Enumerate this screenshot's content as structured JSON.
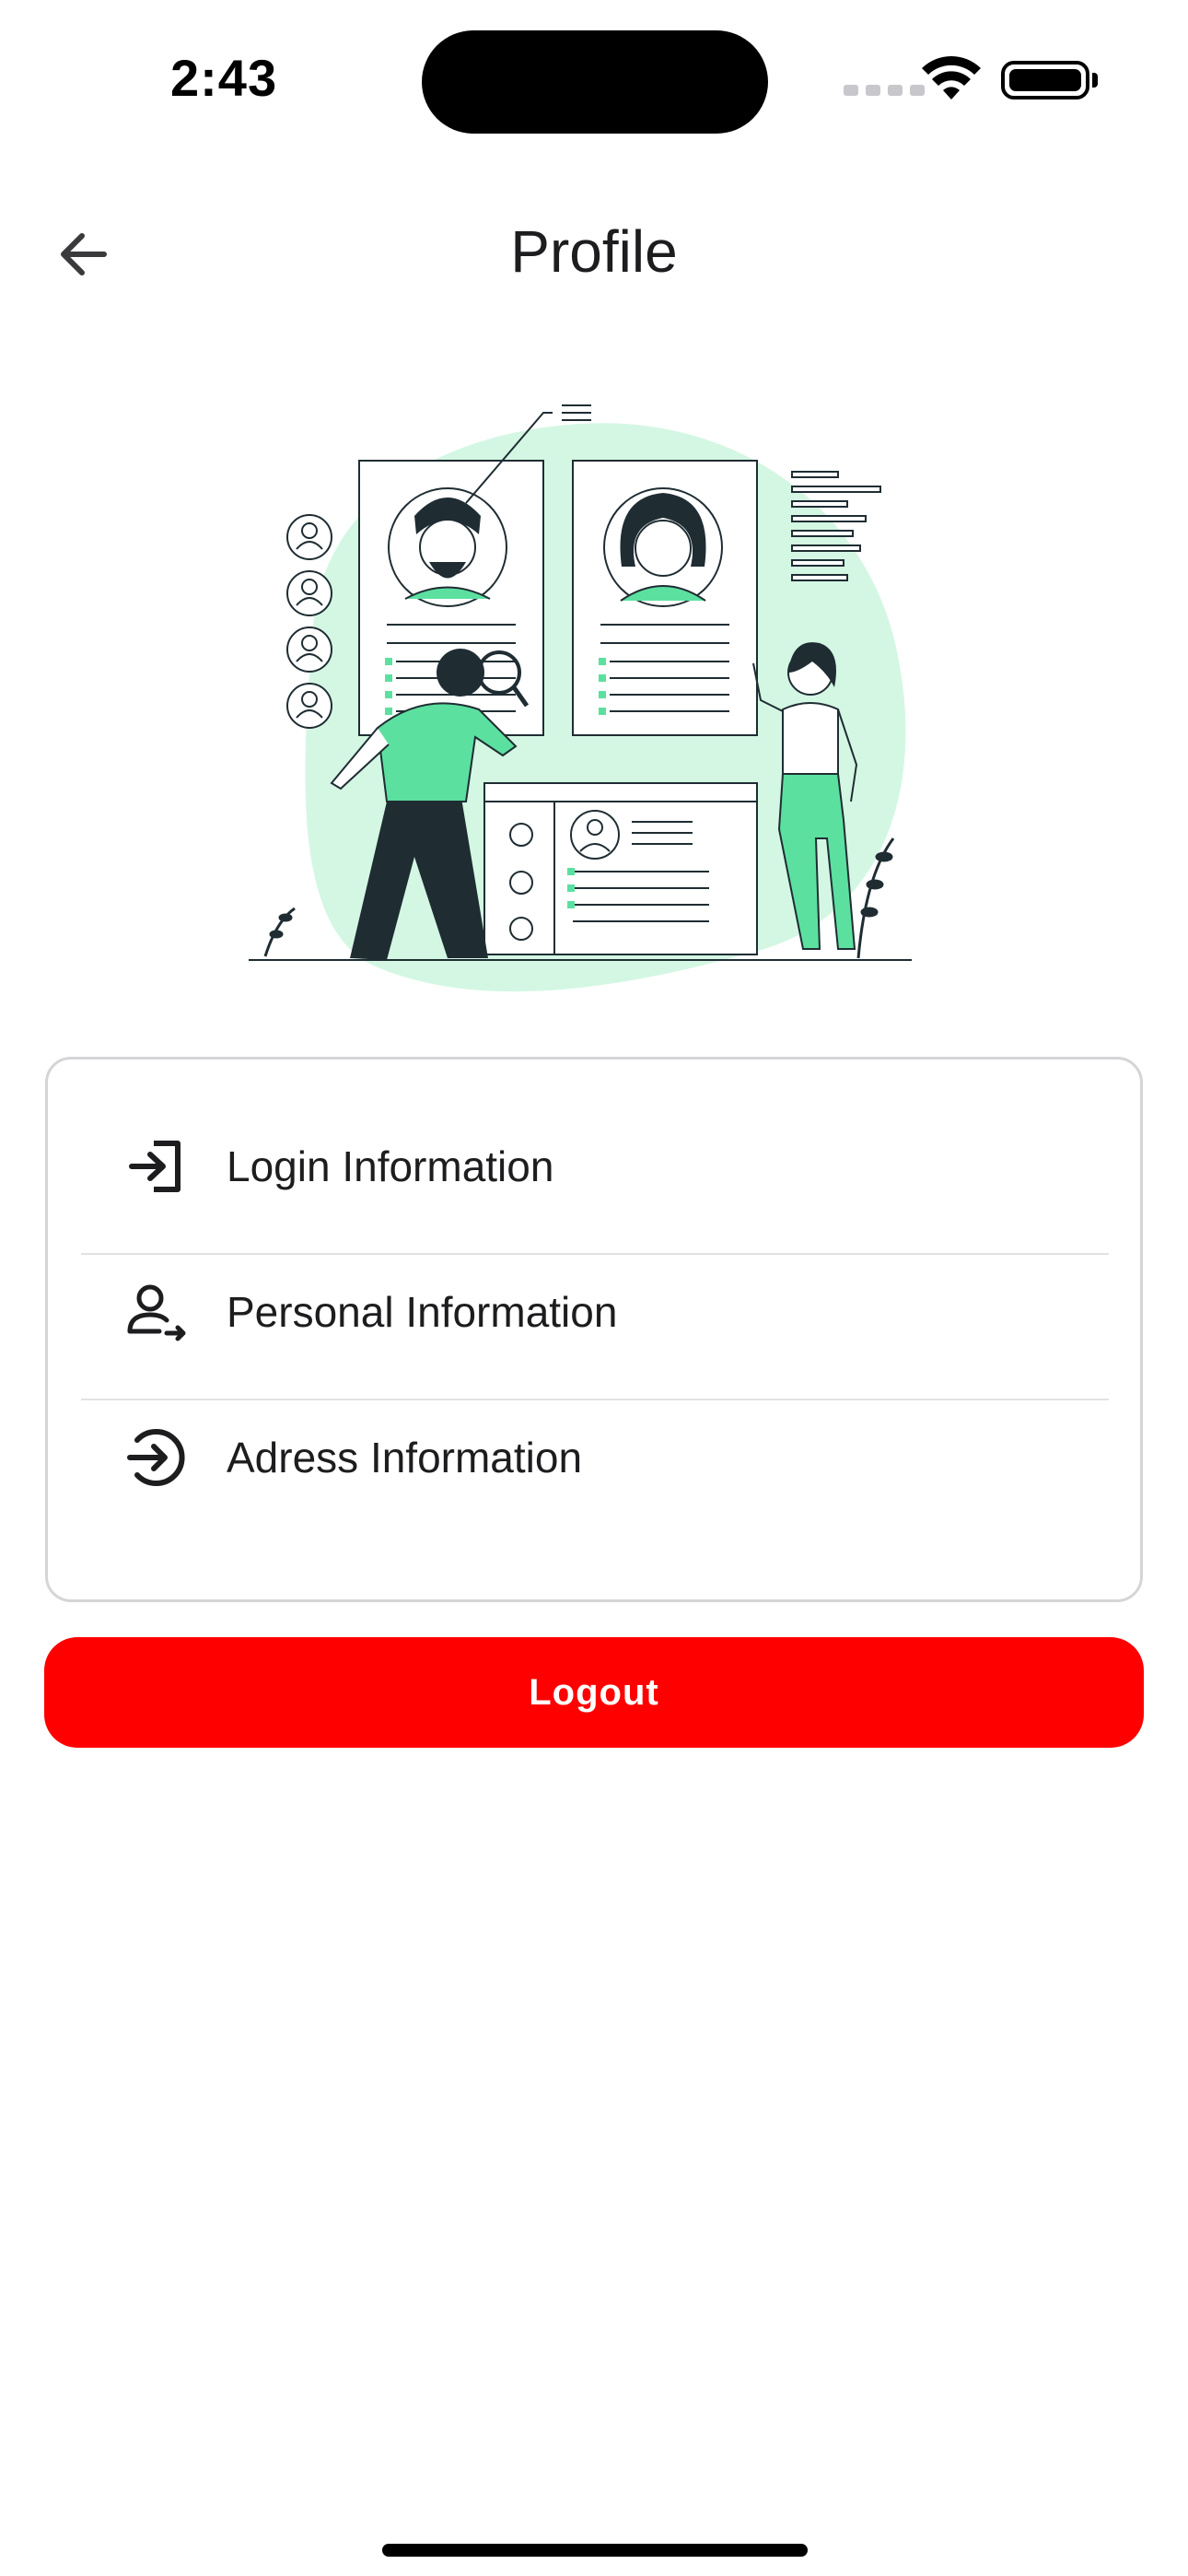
{
  "status_bar": {
    "time": "2:43"
  },
  "header": {
    "title": "Profile",
    "back_icon": "arrow-left-icon"
  },
  "menu": {
    "items": [
      {
        "label": "Login Information",
        "icon": "login-icon"
      },
      {
        "label": "Personal Information",
        "icon": "user-arrow-icon"
      },
      {
        "label": "Adress Information",
        "icon": "circle-arrow-in-icon"
      }
    ]
  },
  "logout": {
    "label": "Logout",
    "color": "#ff0000"
  },
  "colors": {
    "accent_green": "#5ce0a0",
    "blob_green": "#d4f7e4",
    "dark": "#1f2d33"
  }
}
